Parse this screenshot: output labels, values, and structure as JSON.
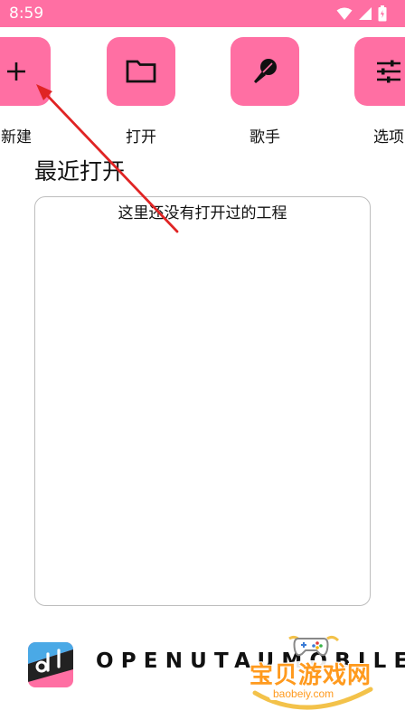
{
  "status_bar": {
    "time": "8:59",
    "icons": [
      "wifi-icon",
      "signal-icon",
      "battery-icon"
    ]
  },
  "quick_actions": [
    {
      "label": "新建",
      "icon": "plus-icon"
    },
    {
      "label": "打开",
      "icon": "folder-icon"
    },
    {
      "label": "歌手",
      "icon": "microphone-icon"
    },
    {
      "label": "选项",
      "icon": "sliders-icon"
    }
  ],
  "recent": {
    "title": "最近打开",
    "empty_text": "这里还没有打开过的工程"
  },
  "footer": {
    "wordmark": "OPENUTAUMOBILE"
  },
  "watermark": {
    "text": "宝贝游戏网",
    "url": "baobeiy.com"
  },
  "colors": {
    "accent": "#ff6fa3",
    "annotation": "#e02424",
    "watermark": "#ff9a1e"
  }
}
